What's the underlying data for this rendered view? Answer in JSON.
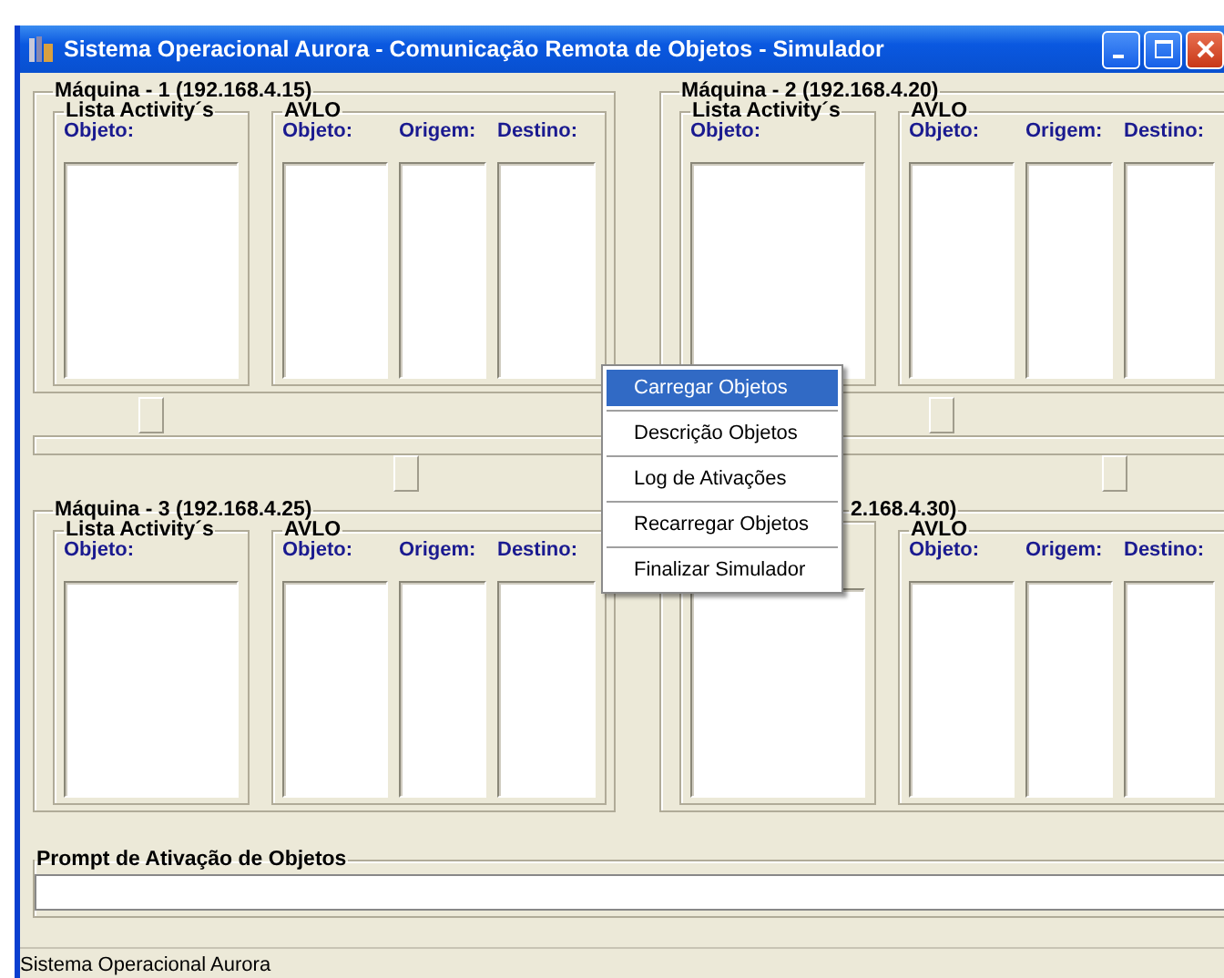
{
  "window": {
    "title": "Sistema Operacional Aurora - Comunicação Remota de Objetos - Simulador"
  },
  "machines": [
    {
      "title": "Máquina - 1  (192.168.4.15)",
      "activity_group": "Lista Activity´s",
      "activity_column": "Objeto:",
      "avlo_group": "AVLO",
      "avlo_columns": [
        "Objeto:",
        "Origem:",
        "Destino:"
      ]
    },
    {
      "title": "Máquina - 2  (192.168.4.20)",
      "activity_group": "Lista Activity´s",
      "activity_column": "Objeto:",
      "avlo_group": "AVLO",
      "avlo_columns": [
        "Objeto:",
        "Origem:",
        "Destino:"
      ]
    },
    {
      "title": "Máquina - 3  (192.168.4.25)",
      "activity_group": "Lista Activity´s",
      "activity_column": "Objeto:",
      "avlo_group": "AVLO",
      "avlo_columns": [
        "Objeto:",
        "Origem:",
        "Destino:"
      ]
    },
    {
      "title": "2.168.4.30)",
      "title_partial": true,
      "avlo_group": "AVLO",
      "avlo_columns": [
        "Objeto:",
        "Origem:",
        "Destino:"
      ]
    }
  ],
  "context_menu": [
    {
      "label": "Carregar Objetos",
      "selected": true
    },
    {
      "label": "Descrição Objetos",
      "selected": false
    },
    {
      "label": "Log de Ativações",
      "selected": false
    },
    {
      "label": "Recarregar Objetos",
      "selected": false
    },
    {
      "label": "Finalizar Simulador",
      "selected": false
    }
  ],
  "prompt": {
    "group": "Prompt de Ativação de Objetos"
  },
  "status_bar": "Sistema Operacional Aurora"
}
